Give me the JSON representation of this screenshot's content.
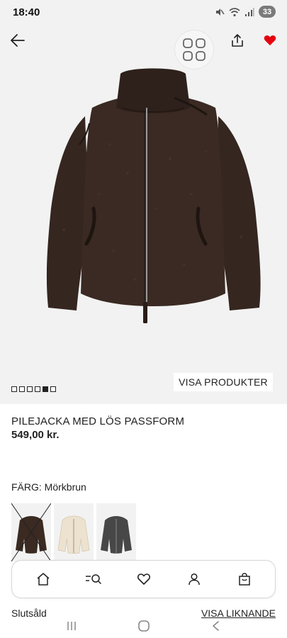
{
  "status_bar": {
    "time": "18:40",
    "battery": "33",
    "icons": [
      "mute-icon",
      "wifi-icon",
      "signal-icon",
      "battery-icon"
    ]
  },
  "hero": {
    "icons": [
      "back-arrow-icon",
      "grid-view-icon",
      "share-icon",
      "heart-filled-icon"
    ],
    "image_pager": {
      "total": 6,
      "active_index": 4
    },
    "visa_produkter_label": "VISA PRODUKTER"
  },
  "product": {
    "title": "PILEJACKA MED LÖS PASSFORM",
    "price": "549,00 kr."
  },
  "color": {
    "label": "FÄRG: Mörkbrun",
    "swatches": [
      {
        "name": "Mörkbrun",
        "color": "#3a2a22",
        "selected": true,
        "crossed_out": true
      },
      {
        "name": "Cream",
        "color": "#ece2cf",
        "selected": false,
        "crossed_out": false
      },
      {
        "name": "Dark grey",
        "color": "#474747",
        "selected": false,
        "crossed_out": false
      }
    ]
  },
  "bottom_nav": {
    "items": [
      "home-icon",
      "search-icon",
      "heart-outline-icon",
      "profile-icon",
      "bag-icon"
    ]
  },
  "footer": {
    "sold_out": "Slutsåld",
    "visa_liknande": "VISA LIKNANDE"
  },
  "colors": {
    "accent_heart": "#e50010",
    "jacket": "#352620",
    "background": "#f2f2f2"
  }
}
